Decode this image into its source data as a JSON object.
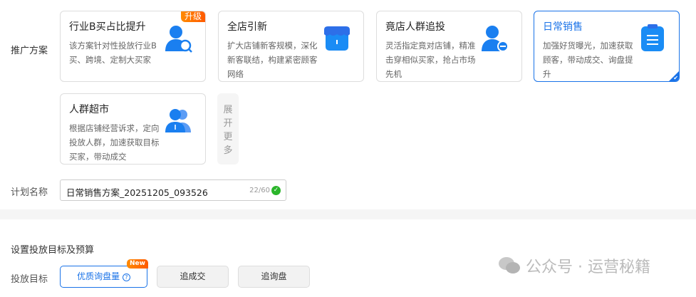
{
  "plan_label": "推广方案",
  "cards": [
    {
      "title": "行业B买占比提升",
      "desc": "该方案针对性投放行业B买、跨境、定制大买家",
      "badge": "升级",
      "icon": "user-search-icon"
    },
    {
      "title": "全店引新",
      "desc": "扩大店铺新客规模，深化新客联结，构建紧密顾客网络",
      "icon": "store-icon"
    },
    {
      "title": "竟店人群追投",
      "desc": "灵活指定竟对店铺，精准击穿相似买家，抢占市场先机",
      "icon": "user-minus-icon"
    },
    {
      "title": "日常销售",
      "desc": "加强好货曝光，加速获取顾客，带动成交、询盘提升",
      "icon": "clipboard-icon",
      "selected": true
    },
    {
      "title": "人群超市",
      "desc": "根据店铺经营诉求，定向投放人群，加速获取目标买家，带动成交",
      "icon": "users-icon"
    }
  ],
  "expand_label": "展开更多",
  "name_label": "计划名称",
  "name_value": "日常销售方案_20251205_093526",
  "name_count": "22/60",
  "section_title": "设置投放目标及预算",
  "goal_label": "投放目标",
  "goals": [
    {
      "label": "优质询盘量",
      "badge": "New",
      "selected": true
    },
    {
      "label": "追成交"
    },
    {
      "label": "追询盘"
    }
  ],
  "watermark": "公众号 · 运营秘籍",
  "colors": {
    "accent": "#1a73e8",
    "badge": "#ff6a00"
  }
}
